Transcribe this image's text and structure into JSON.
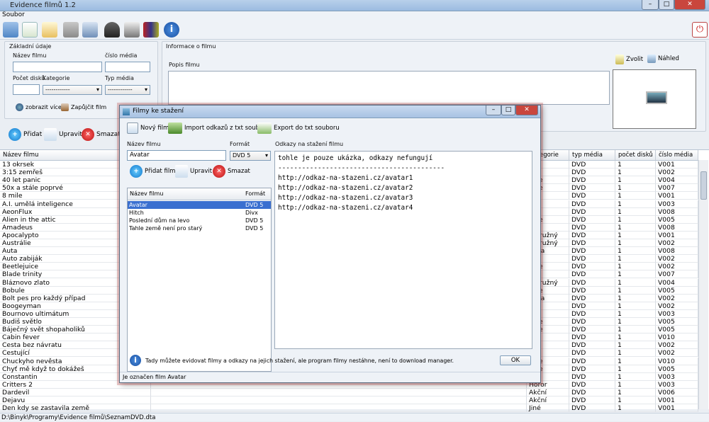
{
  "app": {
    "title": "Evidence filmů 1.2",
    "menu": "Soubor",
    "status": "D:\\Binyk\\Programy\\Evidence filmů\\SeznamDVD.dta"
  },
  "basic": {
    "title": "Základní údaje",
    "name_label": "Název filmu",
    "media_no_label": "číslo média",
    "discs_label": "Počet disků",
    "category_label": "Kategorie",
    "category_value": "------------",
    "media_type_label": "Typ média",
    "media_type_value": "------------",
    "show_more": "zobrazit více",
    "borrow": "Zapůjčit film"
  },
  "info": {
    "title": "Informace o filmu",
    "desc_label": "Popis filmu",
    "choose": "Zvolit",
    "preview": "Náhled"
  },
  "actions": {
    "add": "Přidat",
    "edit": "Upravit",
    "delete": "Smazat"
  },
  "table": {
    "headers": [
      "Název filmu",
      "Kategorie",
      "typ média",
      "počet disků",
      "číslo média"
    ],
    "names": [
      "13 okrsek",
      "3:15 zemřeš",
      "40 let panic",
      "50x a stále poprvé",
      "8 mile",
      "A.I. umělá inteligence",
      "AeonFlux",
      "Alien in the attic",
      "Amadeus",
      "Apocalypto",
      "Austrálie",
      "Auta",
      "Auto zabiják",
      "Beetlejuice",
      "Blade trinity",
      "Bláznovo zlato",
      "Bobule",
      "Bolt pes pro každý případ",
      "Boogeyman",
      "Bournovo ultimátum",
      "Budiš světlo",
      "Báječný svět shopaholiků",
      "Cabin fever",
      "Cesta bez návratu",
      "Cestující",
      "Chuckyho nevěsta",
      "Chyť mě když to dokážeš",
      "Constantin",
      "Critters 2",
      "Dardevil",
      "Dejavu",
      "Den kdy se zastavila země"
    ],
    "cats": [
      "",
      "or",
      "edie",
      "edie",
      "",
      "",
      "ní",
      "edie",
      "ma",
      "rodružný",
      "rodružný",
      "ádka",
      "or",
      "edie",
      "or",
      "rodružný",
      "edie",
      "ádka",
      "or",
      "or",
      "edie",
      "edie",
      "or",
      "ma",
      "",
      "edie",
      "edie",
      "",
      "Horor",
      "Akční",
      "Akční",
      "Jiné"
    ],
    "types": [
      "DVD",
      "DVD",
      "DVD",
      "DVD",
      "DVD",
      "DVD",
      "DVD",
      "DVD",
      "DVD",
      "DVD",
      "DVD",
      "DVD",
      "DVD",
      "DVD",
      "DVD",
      "DVD",
      "DVD",
      "DVD",
      "DVD",
      "DVD",
      "DVD",
      "DVD",
      "DVD",
      "DVD",
      "DVD",
      "DVD",
      "DVD",
      "DVD",
      "DVD",
      "DVD",
      "DVD",
      "DVD"
    ],
    "discs": [
      "1",
      "1",
      "1",
      "1",
      "1",
      "1",
      "1",
      "1",
      "1",
      "1",
      "1",
      "1",
      "1",
      "1",
      "1",
      "1",
      "1",
      "1",
      "1",
      "1",
      "1",
      "1",
      "1",
      "1",
      "1",
      "1",
      "1",
      "1",
      "1",
      "1",
      "1",
      "1"
    ],
    "numbers": [
      "V001",
      "V002",
      "V004",
      "V007",
      "V001",
      "V003",
      "V008",
      "V005",
      "V008",
      "V001",
      "V002",
      "V008",
      "V002",
      "V002",
      "V007",
      "V004",
      "V005",
      "V002",
      "V002",
      "V003",
      "V005",
      "V005",
      "V010",
      "V002",
      "V002",
      "V010",
      "V005",
      "V003",
      "V003",
      "V006",
      "V001",
      "V001"
    ]
  },
  "dialog": {
    "title": "Filmy ke stažení",
    "new_film": "Nový film",
    "import": "Import odkazů z txt souboru",
    "export": "Export do txt souboru",
    "name_label": "Název filmu",
    "name_value": "Avatar",
    "format_label": "Formát",
    "format_value": "DVD 5",
    "links_label": "Odkazy na stažení filmu",
    "add": "Přidat film",
    "edit": "Upravit",
    "delete": "Smazat",
    "col_name": "Název filmu",
    "col_format": "Formát",
    "films": [
      {
        "name": "Avatar",
        "format": "DVD 5"
      },
      {
        "name": "Hitch",
        "format": "Divx"
      },
      {
        "name": "Poslední dům na levo",
        "format": "DVD 5"
      },
      {
        "name": "Tahle země není pro starý",
        "format": "DVD 5"
      }
    ],
    "links": [
      "tohle je pouze ukázka, odkazy nefungují",
      "------------------------------------------",
      "http://odkaz-na-stazeni.cz/avatar1",
      "http://odkaz-na-stazeni.cz/avatar2",
      "http://odkaz-na-stazeni.cz/avatar3",
      "http://odkaz-na-stazeni.cz/avatar4"
    ],
    "info_text": "Tady můžete evidovat filmy a odkazy na jejich stažení, ale program filmy nestáhne, není to download manager.",
    "ok": "OK",
    "status": "Je označen film Avatar"
  }
}
